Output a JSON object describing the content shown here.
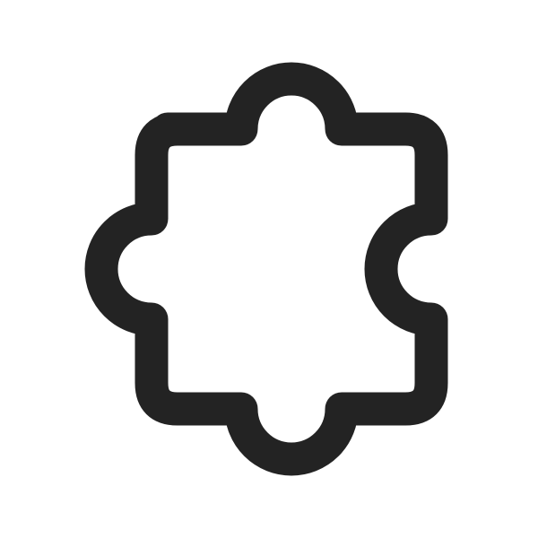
{
  "icon": {
    "name": "puzzle-piece-icon",
    "style": "outline",
    "stroke_color": "#232323",
    "background_color": "#ffffff"
  }
}
